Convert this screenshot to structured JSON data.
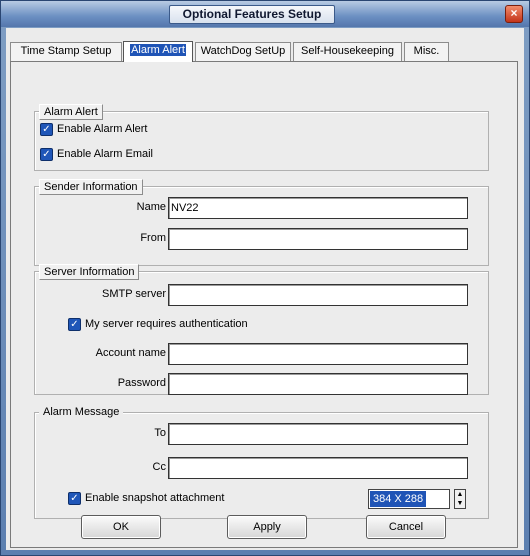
{
  "window": {
    "title": "Optional Features Setup",
    "close_glyph": "×"
  },
  "tabs": [
    {
      "label": "Time Stamp Setup"
    },
    {
      "label": "Alarm Alert",
      "active": true
    },
    {
      "label": "WatchDog SetUp"
    },
    {
      "label": "Self-Housekeeping"
    },
    {
      "label": "Misc."
    }
  ],
  "alarm_alert": {
    "legend": "Alarm Alert",
    "enable_alarm_alert": {
      "label": "Enable Alarm Alert",
      "checked": true
    },
    "enable_alarm_email": {
      "label": "Enable Alarm Email",
      "checked": true
    }
  },
  "sender": {
    "legend": "Sender Information",
    "name_label": "Name",
    "name_value": "NV22",
    "from_label": "From",
    "from_value": ""
  },
  "server": {
    "legend": "Server Information",
    "smtp_label": "SMTP server",
    "smtp_value": "",
    "auth": {
      "label": "My server requires authentication",
      "checked": true
    },
    "account_label": "Account name",
    "account_value": "",
    "password_label": "Password",
    "password_value": ""
  },
  "alarm_message": {
    "legend": "Alarm Message",
    "to_label": "To",
    "to_value": "",
    "cc_label": "Cc",
    "cc_value": "",
    "snapshot": {
      "label": "Enable snapshot attachment",
      "checked": true
    },
    "resolution": "384 X 288"
  },
  "buttons": {
    "ok": "OK",
    "apply": "Apply",
    "cancel": "Cancel"
  },
  "check_glyph": "✓",
  "spin_up": "▲",
  "spin_down": "▼"
}
